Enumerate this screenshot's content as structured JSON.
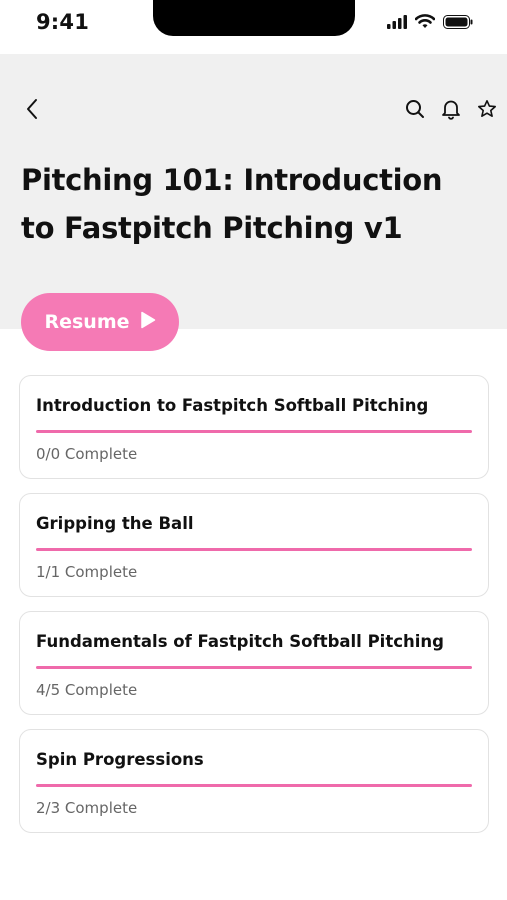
{
  "status_bar": {
    "time": "9:41",
    "icons": [
      "signal-icon",
      "wifi-icon",
      "battery-icon"
    ]
  },
  "header": {
    "back_icon": "chevron-left-icon",
    "actions": [
      "search-icon",
      "bell-icon",
      "star-icon"
    ],
    "title": "Pitching 101: Introduction to Fastpitch Pitching v1"
  },
  "resume": {
    "label": "Resume",
    "icon": "play-icon"
  },
  "modules": [
    {
      "title": "Introduction to Fastpitch Softball Pitching",
      "status": "0/0 Complete",
      "progress": 1.0
    },
    {
      "title": "Gripping the Ball",
      "status": "1/1 Complete",
      "progress": 1.0
    },
    {
      "title": "Fundamentals of Fastpitch Softball Pitching",
      "status": "4/5 Complete",
      "progress": 1.0
    },
    {
      "title": "Spin Progressions",
      "status": "2/3 Complete",
      "progress": 1.0
    }
  ],
  "colors": {
    "accent": "#f57ab5",
    "progress": "#ef6aab",
    "header_bg": "#f0f0f0"
  }
}
